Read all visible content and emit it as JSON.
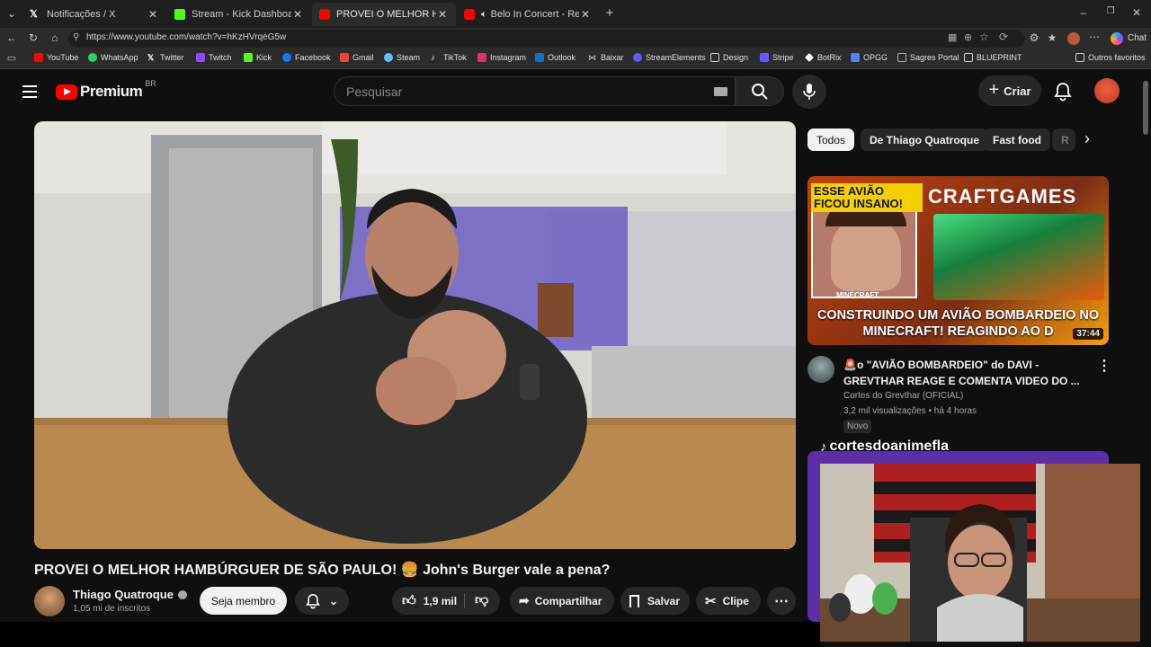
{
  "browser": {
    "tabs": [
      {
        "title": "Notificações / X",
        "icon": "x-logo",
        "color": "#ffffff"
      },
      {
        "title": "Stream - Kick Dashboard",
        "icon": "kick-logo",
        "color": "#53fc18"
      },
      {
        "title": "PROVEI O MELHOR HAMBÚRGUE",
        "icon": "youtube-logo",
        "color": "#ff0000"
      },
      {
        "title": "Belo In Concert - Reinventar/F",
        "icon": "youtube-logo",
        "color": "#ff0000"
      }
    ],
    "url": "https://www.youtube.com/watch?v=hKzHVrqeG5w",
    "copilot_label": "Chat",
    "bookmarks": [
      {
        "label": "YouTube",
        "color": "#ff0000"
      },
      {
        "label": "WhatsApp",
        "color": "#25d366"
      },
      {
        "label": "Twitter",
        "color": "#ffffff"
      },
      {
        "label": "Twitch",
        "color": "#9146ff"
      },
      {
        "label": "Kick",
        "color": "#53fc18"
      },
      {
        "label": "Facebook",
        "color": "#1877f2"
      },
      {
        "label": "Gmail",
        "color": "#ea4335"
      },
      {
        "label": "Steam",
        "color": "#66c0f4"
      },
      {
        "label": "TikTok",
        "color": "#ffffff"
      },
      {
        "label": "Instagram",
        "color": "#e1306c"
      },
      {
        "label": "Outlook",
        "color": "#0078d4"
      },
      {
        "label": "Baixar",
        "color": "#cccccc"
      },
      {
        "label": "StreamElements",
        "color": "#5b5bff"
      },
      {
        "label": "Design",
        "color": "#cccccc"
      },
      {
        "label": "Stripe",
        "color": "#635bff"
      },
      {
        "label": "BotRix",
        "color": "#ffffff"
      },
      {
        "label": "OPGG",
        "color": "#5383e8"
      },
      {
        "label": "Sagres Portal",
        "color": "#cccccc"
      },
      {
        "label": "BLUEPRINT",
        "color": "#cccccc"
      }
    ],
    "other_favorites": "Outros favoritos"
  },
  "youtube": {
    "logo_text": "Premium",
    "region": "BR",
    "search_placeholder": "Pesquisar",
    "create_label": "Criar",
    "video": {
      "title": "PROVEI O MELHOR HAMBÚRGUER DE SÃO PAULO! 🍔 John's Burger vale a pena?",
      "channel": "Thiago Quatroque",
      "subscribers": "1,05 mi de inscritos",
      "member_label": "Seja membro",
      "likes": "1,9 mil",
      "share_label": "Compartilhar",
      "save_label": "Salvar",
      "clip_label": "Clipe"
    },
    "chips": [
      "Todos",
      "De Thiago Quatroque",
      "Fast food",
      "R"
    ],
    "recommended": {
      "thumb_top_left": "ESSE AVIÃO FICOU INSANO!",
      "thumb_top_right": "CRAFTGAMES",
      "thumb_caption": "MINECRAFT",
      "thumb_bottom": "CONSTRUINDO UM AVIÃO BOMBARDEIO NO MINECRAFT! REAGINDO AO D",
      "duration": "37:44",
      "title_line1": "🚨o \"AVIÃO BOMBARDEIO\" do DAVI -",
      "title_line2": "GREVTHAR REAGE E COMENTA VIDEO DO ...",
      "channel": "Cortes do Grevthar (OFICIAL)",
      "meta": "3,2 mil visualizações • há 4 horas",
      "badge": "Novo"
    }
  },
  "overlay": {
    "tiktok_handle": "cortesdoanimefla"
  }
}
